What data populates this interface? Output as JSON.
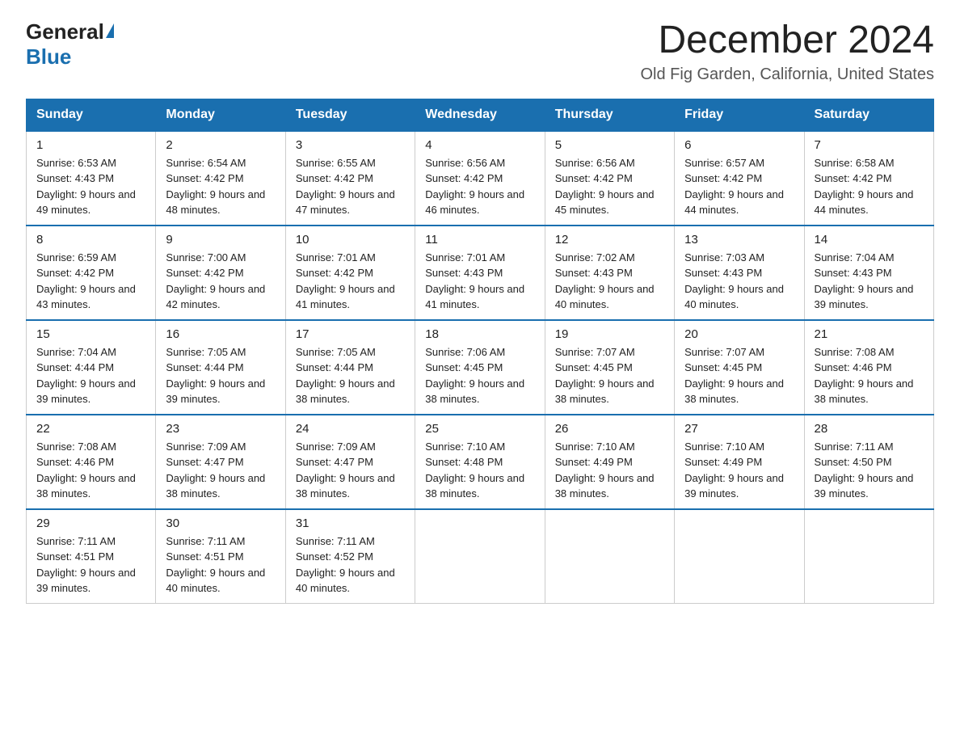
{
  "logo": {
    "general": "General",
    "blue": "Blue"
  },
  "header": {
    "title": "December 2024",
    "subtitle": "Old Fig Garden, California, United States"
  },
  "days_of_week": [
    "Sunday",
    "Monday",
    "Tuesday",
    "Wednesday",
    "Thursday",
    "Friday",
    "Saturday"
  ],
  "weeks": [
    [
      {
        "day": "1",
        "sunrise": "6:53 AM",
        "sunset": "4:43 PM",
        "daylight": "9 hours and 49 minutes."
      },
      {
        "day": "2",
        "sunrise": "6:54 AM",
        "sunset": "4:42 PM",
        "daylight": "9 hours and 48 minutes."
      },
      {
        "day": "3",
        "sunrise": "6:55 AM",
        "sunset": "4:42 PM",
        "daylight": "9 hours and 47 minutes."
      },
      {
        "day": "4",
        "sunrise": "6:56 AM",
        "sunset": "4:42 PM",
        "daylight": "9 hours and 46 minutes."
      },
      {
        "day": "5",
        "sunrise": "6:56 AM",
        "sunset": "4:42 PM",
        "daylight": "9 hours and 45 minutes."
      },
      {
        "day": "6",
        "sunrise": "6:57 AM",
        "sunset": "4:42 PM",
        "daylight": "9 hours and 44 minutes."
      },
      {
        "day": "7",
        "sunrise": "6:58 AM",
        "sunset": "4:42 PM",
        "daylight": "9 hours and 44 minutes."
      }
    ],
    [
      {
        "day": "8",
        "sunrise": "6:59 AM",
        "sunset": "4:42 PM",
        "daylight": "9 hours and 43 minutes."
      },
      {
        "day": "9",
        "sunrise": "7:00 AM",
        "sunset": "4:42 PM",
        "daylight": "9 hours and 42 minutes."
      },
      {
        "day": "10",
        "sunrise": "7:01 AM",
        "sunset": "4:42 PM",
        "daylight": "9 hours and 41 minutes."
      },
      {
        "day": "11",
        "sunrise": "7:01 AM",
        "sunset": "4:43 PM",
        "daylight": "9 hours and 41 minutes."
      },
      {
        "day": "12",
        "sunrise": "7:02 AM",
        "sunset": "4:43 PM",
        "daylight": "9 hours and 40 minutes."
      },
      {
        "day": "13",
        "sunrise": "7:03 AM",
        "sunset": "4:43 PM",
        "daylight": "9 hours and 40 minutes."
      },
      {
        "day": "14",
        "sunrise": "7:04 AM",
        "sunset": "4:43 PM",
        "daylight": "9 hours and 39 minutes."
      }
    ],
    [
      {
        "day": "15",
        "sunrise": "7:04 AM",
        "sunset": "4:44 PM",
        "daylight": "9 hours and 39 minutes."
      },
      {
        "day": "16",
        "sunrise": "7:05 AM",
        "sunset": "4:44 PM",
        "daylight": "9 hours and 39 minutes."
      },
      {
        "day": "17",
        "sunrise": "7:05 AM",
        "sunset": "4:44 PM",
        "daylight": "9 hours and 38 minutes."
      },
      {
        "day": "18",
        "sunrise": "7:06 AM",
        "sunset": "4:45 PM",
        "daylight": "9 hours and 38 minutes."
      },
      {
        "day": "19",
        "sunrise": "7:07 AM",
        "sunset": "4:45 PM",
        "daylight": "9 hours and 38 minutes."
      },
      {
        "day": "20",
        "sunrise": "7:07 AM",
        "sunset": "4:45 PM",
        "daylight": "9 hours and 38 minutes."
      },
      {
        "day": "21",
        "sunrise": "7:08 AM",
        "sunset": "4:46 PM",
        "daylight": "9 hours and 38 minutes."
      }
    ],
    [
      {
        "day": "22",
        "sunrise": "7:08 AM",
        "sunset": "4:46 PM",
        "daylight": "9 hours and 38 minutes."
      },
      {
        "day": "23",
        "sunrise": "7:09 AM",
        "sunset": "4:47 PM",
        "daylight": "9 hours and 38 minutes."
      },
      {
        "day": "24",
        "sunrise": "7:09 AM",
        "sunset": "4:47 PM",
        "daylight": "9 hours and 38 minutes."
      },
      {
        "day": "25",
        "sunrise": "7:10 AM",
        "sunset": "4:48 PM",
        "daylight": "9 hours and 38 minutes."
      },
      {
        "day": "26",
        "sunrise": "7:10 AM",
        "sunset": "4:49 PM",
        "daylight": "9 hours and 38 minutes."
      },
      {
        "day": "27",
        "sunrise": "7:10 AM",
        "sunset": "4:49 PM",
        "daylight": "9 hours and 39 minutes."
      },
      {
        "day": "28",
        "sunrise": "7:11 AM",
        "sunset": "4:50 PM",
        "daylight": "9 hours and 39 minutes."
      }
    ],
    [
      {
        "day": "29",
        "sunrise": "7:11 AM",
        "sunset": "4:51 PM",
        "daylight": "9 hours and 39 minutes."
      },
      {
        "day": "30",
        "sunrise": "7:11 AM",
        "sunset": "4:51 PM",
        "daylight": "9 hours and 40 minutes."
      },
      {
        "day": "31",
        "sunrise": "7:11 AM",
        "sunset": "4:52 PM",
        "daylight": "9 hours and 40 minutes."
      },
      null,
      null,
      null,
      null
    ]
  ]
}
